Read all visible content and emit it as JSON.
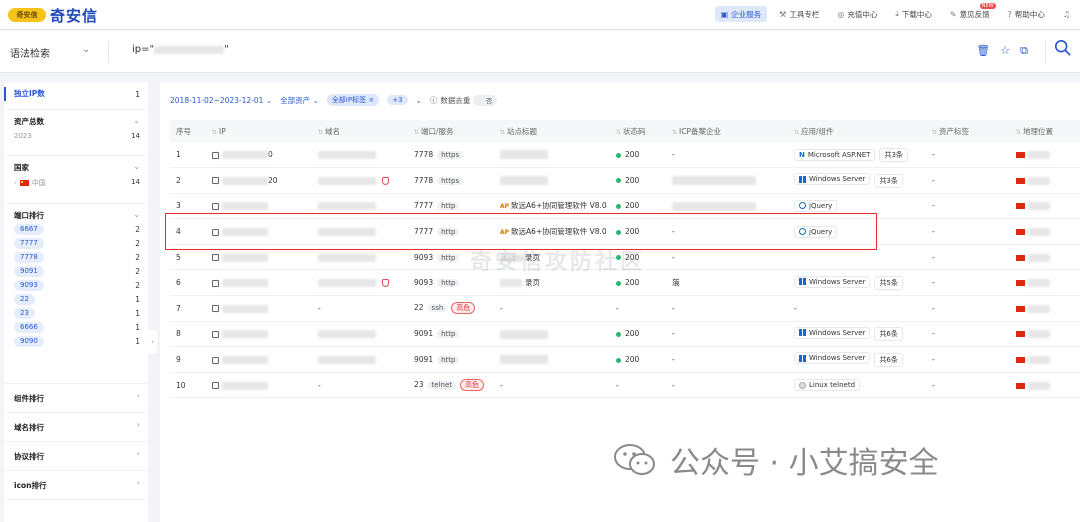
{
  "brand": {
    "badge": "奇安信",
    "name": "奇安信"
  },
  "topnav": [
    {
      "icon": "briefcase-icon",
      "glyph": "▣",
      "label": "企业服务",
      "active": true
    },
    {
      "icon": "tools-icon",
      "glyph": "⚒",
      "label": "工具专栏",
      "active": false
    },
    {
      "icon": "coin-icon",
      "glyph": "◎",
      "label": "充值中心",
      "active": false
    },
    {
      "icon": "download-icon",
      "glyph": "⤓",
      "label": "下载中心",
      "active": false
    },
    {
      "icon": "feedback-icon",
      "glyph": "✎",
      "label": "意见反馈",
      "active": false,
      "badge": "NEW"
    },
    {
      "icon": "help-icon",
      "glyph": "?",
      "label": "帮助中心",
      "active": false
    },
    {
      "icon": "bell-icon",
      "glyph": "♫",
      "label": "",
      "active": false
    }
  ],
  "search": {
    "mode": "语法检索",
    "prefix": "ip=\"",
    "suffix": "\""
  },
  "sidebar": {
    "unique_ip": {
      "label": "独立IP数",
      "value": "1"
    },
    "asset_total": {
      "label": "资产总数",
      "year": "2023",
      "value": "14"
    },
    "country": {
      "label": "国家",
      "name": "中国",
      "value": "14"
    },
    "ports": {
      "label": "端口排行",
      "items": [
        {
          "port": "6667",
          "count": "2"
        },
        {
          "port": "7777",
          "count": "2"
        },
        {
          "port": "7778",
          "count": "2"
        },
        {
          "port": "9091",
          "count": "2"
        },
        {
          "port": "9093",
          "count": "2"
        },
        {
          "port": "22",
          "count": "1"
        },
        {
          "port": "23",
          "count": "1"
        },
        {
          "port": "6666",
          "count": "1"
        },
        {
          "port": "9090",
          "count": "1"
        }
      ]
    },
    "more": [
      "组件排行",
      "域名排行",
      "协议排行",
      "icon排行"
    ]
  },
  "filters": {
    "date_range": "2018-11-02~2023-12-01",
    "asset": "全部资产",
    "ip_tag": "全部IP标签",
    "plus": "+3",
    "dedupe": "数据去重",
    "toggle": "否"
  },
  "table": {
    "headers": [
      "序号",
      "IP",
      "域名",
      "端口/服务",
      "站点标题",
      "状态码",
      "ICP备案企业",
      "应用/组件",
      "资产标签",
      "地理位置"
    ],
    "rows": [
      {
        "no": "1",
        "ip_tail": "0",
        "port": "7778",
        "svc": "https",
        "danger": "",
        "title": "",
        "status": "200",
        "icp": "-",
        "comp": "Microsoft ASP.NET",
        "comp_icon": "asp",
        "more": "共3条",
        "tag": "-"
      },
      {
        "no": "2",
        "ip_tail": "20",
        "port": "7778",
        "svc": "https",
        "danger": "",
        "title": "",
        "status": "200",
        "icp": "",
        "comp": "Windows Server",
        "comp_icon": "win",
        "more": "共3条",
        "tag": "-"
      },
      {
        "no": "3",
        "ip_tail": "",
        "port": "7777",
        "svc": "http",
        "danger": "",
        "title": "致远A6+协同管理软件 V8.0",
        "status": "200",
        "icp": "",
        "comp": "jQuery",
        "comp_icon": "jq",
        "more": "",
        "tag": "-"
      },
      {
        "no": "4",
        "ip_tail": "",
        "port": "7777",
        "svc": "http",
        "danger": "",
        "title": "致远A6+协同管理软件 V8.0",
        "status": "200",
        "icp": "-",
        "comp": "jQuery",
        "comp_icon": "jq",
        "more": "",
        "tag": "-"
      },
      {
        "no": "5",
        "ip_tail": "",
        "port": "9093",
        "svc": "http",
        "danger": "",
        "title": "录页",
        "status": "200",
        "icp": "-",
        "comp": "",
        "comp_icon": "",
        "more": "",
        "tag": "-"
      },
      {
        "no": "6",
        "ip_tail": "",
        "port": "9093",
        "svc": "http",
        "danger": "",
        "title": "录页",
        "status": "200",
        "icp": "蒗",
        "comp": "Windows Server",
        "comp_icon": "win",
        "more": "共5条",
        "tag": "-"
      },
      {
        "no": "7",
        "ip_tail": "",
        "port": "22",
        "svc": "ssh",
        "danger": "高危",
        "title": "-",
        "status": "-",
        "icp": "-",
        "comp": "-",
        "comp_icon": "",
        "more": "",
        "tag": "-"
      },
      {
        "no": "8",
        "ip_tail": "",
        "port": "9091",
        "svc": "http",
        "danger": "",
        "title": "",
        "status": "200",
        "icp": "-",
        "comp": "Windows Server",
        "comp_icon": "win",
        "more": "共6条",
        "tag": "-"
      },
      {
        "no": "9",
        "ip_tail": "",
        "port": "9091",
        "svc": "http",
        "danger": "",
        "title": "",
        "status": "200",
        "icp": "-",
        "comp": "Windows Server",
        "comp_icon": "win",
        "more": "共6条",
        "tag": "-"
      },
      {
        "no": "10",
        "ip_tail": "",
        "port": "23",
        "svc": "telnet",
        "danger": "高危",
        "title": "-",
        "status": "-",
        "icp": "-",
        "comp": "Linux telnetd",
        "comp_icon": "lnx",
        "more": "",
        "tag": "-"
      }
    ]
  },
  "watermark": {
    "center": "奇安信攻防社区",
    "footer": "公众号 · 小艾搞安全"
  }
}
